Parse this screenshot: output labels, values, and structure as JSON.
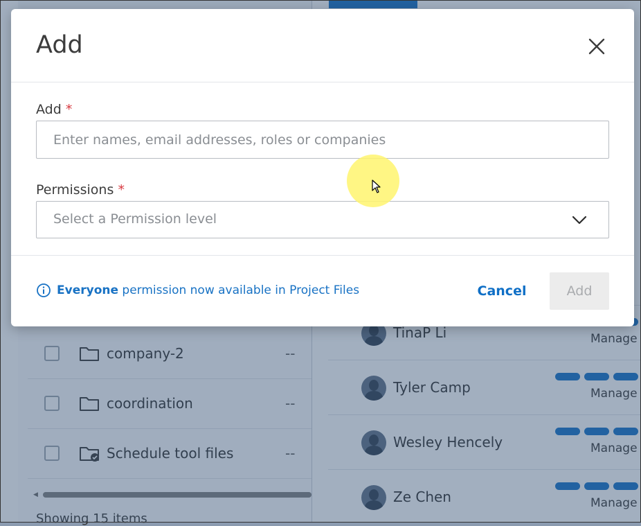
{
  "background": {
    "folders": [
      {
        "name": "company-2",
        "size": "--"
      },
      {
        "name": "coordination",
        "size": "--"
      },
      {
        "name": "Schedule tool files",
        "size": "--"
      }
    ],
    "showing_text": "Showing 15 items",
    "members": [
      {
        "name": "TinaP Li",
        "permission": "Manage"
      },
      {
        "name": "Tyler Camp",
        "permission": "Manage"
      },
      {
        "name": "Wesley Hencely",
        "permission": "Manage"
      },
      {
        "name": "Ze Chen",
        "permission": "Manage"
      }
    ]
  },
  "modal": {
    "title": "Add",
    "add_field": {
      "label": "Add",
      "required_mark": "*",
      "placeholder": "Enter names, email addresses, roles or companies",
      "value": ""
    },
    "permissions_field": {
      "label": "Permissions",
      "required_mark": "*",
      "placeholder": "Select a Permission level"
    },
    "info": {
      "highlight": "Everyone",
      "text": " permission now available in Project Files",
      "icon": "info-circle-icon"
    },
    "cancel_label": "Cancel",
    "add_label": "Add"
  },
  "colors": {
    "accent": "#0f6fc6",
    "required": "#d7383f",
    "info_text": "#1872c4",
    "disabled_bg": "#ececec"
  }
}
